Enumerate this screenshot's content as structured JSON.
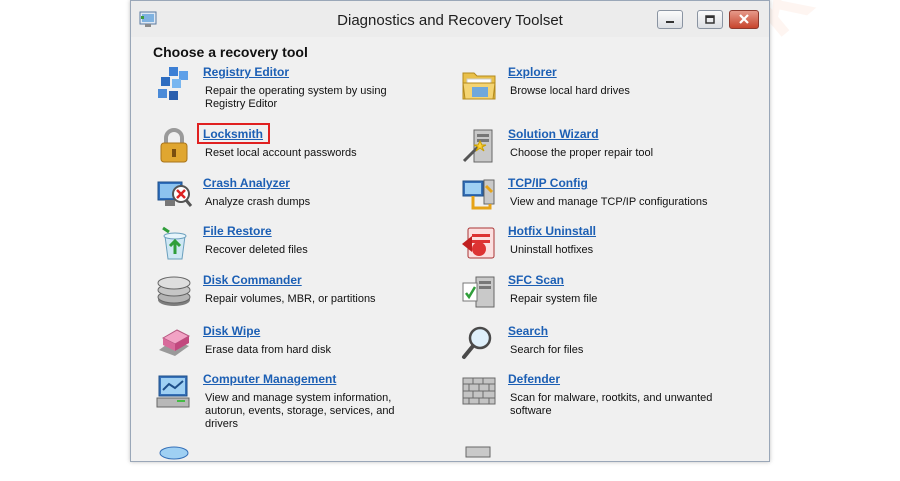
{
  "window": {
    "title": "Diagnostics and Recovery Toolset",
    "heading": "Choose a recovery tool"
  },
  "tools_left": [
    {
      "name": "Registry Editor",
      "desc": "Repair the operating system by using Registry Editor",
      "icon": "registry-icon"
    },
    {
      "name": "Locksmith",
      "desc": "Reset local account passwords",
      "icon": "padlock-icon"
    },
    {
      "name": "Crash Analyzer",
      "desc": "Analyze crash dumps",
      "icon": "crash-analyzer-icon"
    },
    {
      "name": "File Restore",
      "desc": "Recover deleted files",
      "icon": "recycle-bin-icon"
    },
    {
      "name": "Disk Commander",
      "desc": "Repair volumes, MBR, or partitions",
      "icon": "disk-stack-icon"
    },
    {
      "name": "Disk Wipe",
      "desc": "Erase data from hard disk",
      "icon": "eraser-icon"
    },
    {
      "name": "Computer Management",
      "desc": "View and manage system information, autorun, events, storage, services, and drivers",
      "icon": "computer-management-icon"
    }
  ],
  "tools_right": [
    {
      "name": "Explorer",
      "desc": "Browse local hard drives",
      "icon": "folder-icon"
    },
    {
      "name": "Solution Wizard",
      "desc": "Choose the proper repair tool",
      "icon": "wizard-icon"
    },
    {
      "name": "TCP/IP Config",
      "desc": "View and manage TCP/IP configurations",
      "icon": "network-config-icon"
    },
    {
      "name": "Hotfix Uninstall",
      "desc": "Uninstall hotfixes",
      "icon": "hotfix-icon"
    },
    {
      "name": "SFC Scan",
      "desc": "Repair system file",
      "icon": "sfc-scan-icon"
    },
    {
      "name": "Search",
      "desc": "Search for files",
      "icon": "magnifier-icon"
    },
    {
      "name": "Defender",
      "desc": "Scan for malware, rootkits, and unwanted software",
      "icon": "defender-wall-icon"
    }
  ],
  "watermark": "DEVICE TRICKS",
  "colors": {
    "link": "#1c5fb4",
    "highlight": "#e02020",
    "close_button": "#c7452d"
  }
}
